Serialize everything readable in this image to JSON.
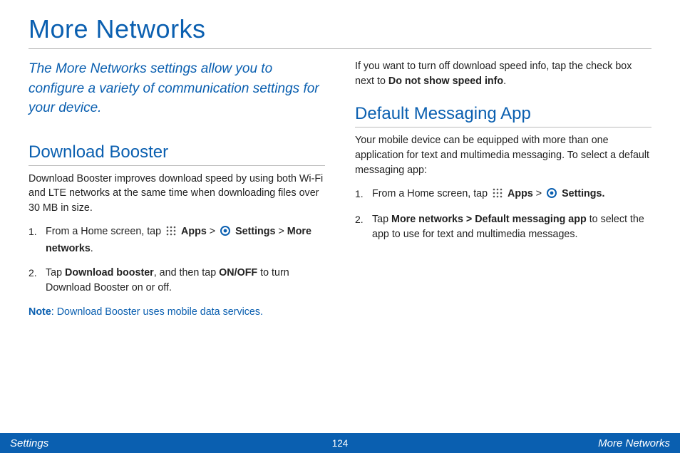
{
  "title": "More Networks",
  "intro": "The More Networks settings allow you to configure a variety of communication settings for your device.",
  "left": {
    "h2": "Download Booster",
    "p1": "Download Booster improves download speed by using both Wi-Fi and LTE networks at the same time when downloading files over 30 MB in size.",
    "step1_a": "From a Home screen, tap ",
    "apps": "Apps",
    "gt": " > ",
    "settings": "Settings",
    "step1_b": " > ",
    "more_net": "More networks",
    "period": ".",
    "step2_a": "Tap ",
    "db": "Download booster",
    "step2_b": ", and then tap ",
    "onoff": "ON/OFF",
    "step2_c": " to turn Download Booster on or off.",
    "note_lbl": "Note",
    "note_txt": ": Download Booster uses mobile data services."
  },
  "right": {
    "p1_a": "If you want to turn off download speed info, tap the check box next to ",
    "p1_b": "Do not show speed info",
    "p1_c": ".",
    "h2": "Default Messaging App",
    "p2": "Your mobile device can be equipped with more than one application for text and multimedia messaging. To select a default messaging app:",
    "step1_a": "From a Home screen, tap ",
    "apps": "Apps",
    "gt": " > ",
    "settings": "Settings.",
    "step2_a": "Tap ",
    "mn": "More networks > Default messaging app",
    "step2_b": " to select the app to use for text and multimedia messages."
  },
  "footer": {
    "left": "Settings",
    "page": "124",
    "right": "More Networks"
  }
}
